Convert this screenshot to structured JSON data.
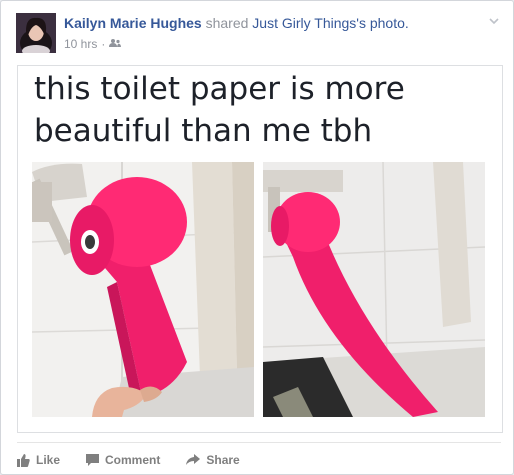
{
  "post": {
    "author": "Kailyn Marie Hughes",
    "action_text": "shared",
    "shared_source": "Just Girly Things's photo.",
    "timestamp": "10 hrs",
    "separator": "·",
    "privacy_icon": "friends-icon"
  },
  "shared_content": {
    "caption": "this toilet paper is more beautiful than me tbh",
    "photos": [
      "pink toilet paper roll photo (left)",
      "pink toilet paper roll photo (right)"
    ]
  },
  "actions": {
    "like_label": "Like",
    "comment_label": "Comment",
    "share_label": "Share"
  },
  "colors": {
    "author_blue": "#365899",
    "meta_gray": "#90949c",
    "toilet_paper_pink": "#ff1f6a"
  }
}
